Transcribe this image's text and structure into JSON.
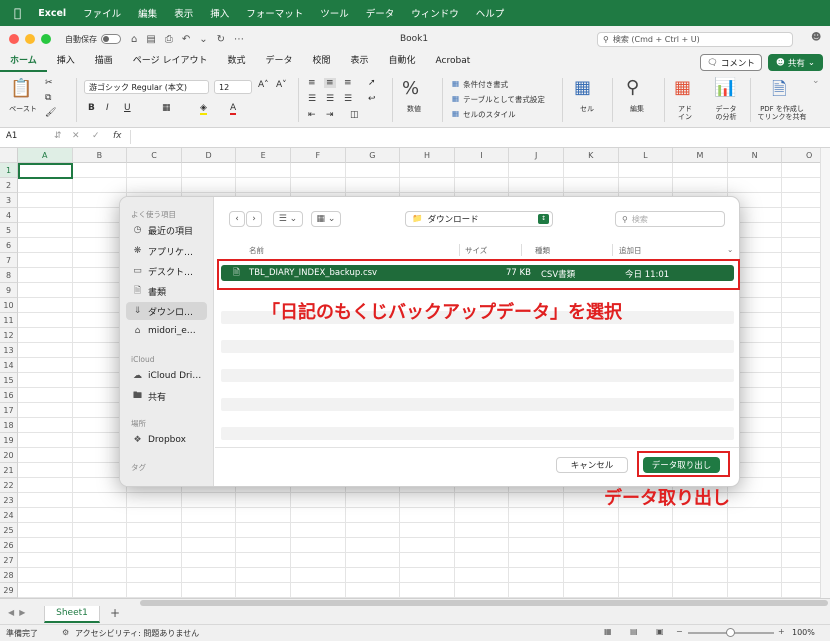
{
  "menubar": {
    "apple": "",
    "app": "Excel",
    "items": [
      "ファイル",
      "編集",
      "表示",
      "挿入",
      "フォーマット",
      "ツール",
      "データ",
      "ウィンドウ",
      "ヘルプ"
    ]
  },
  "titlebar": {
    "autosave": "自動保存",
    "doc_title": "Book1",
    "search_placeholder": "検索 (Cmd + Ctrl + U)"
  },
  "ribbon_tabs": [
    "ホーム",
    "挿入",
    "描画",
    "ページ レイアウト",
    "数式",
    "データ",
    "校閲",
    "表示",
    "自動化",
    "Acrobat"
  ],
  "ribbon_buttons": {
    "comment": "コメント",
    "share": "共有"
  },
  "ribbon": {
    "paste": "ペースト",
    "font_name": "游ゴシック Regular (本文)",
    "font_size": "12",
    "bold": "B",
    "italic": "I",
    "underline": "U",
    "number_label": "数値",
    "cond_format": "条件付き書式",
    "table_format": "テーブルとして書式設定",
    "cell_style": "セルのスタイル",
    "cells": "セル",
    "editing": "編集",
    "addin_1": "アド",
    "addin_2": "イン",
    "analysis_1": "データ",
    "analysis_2": "の分析",
    "pdf_1": "PDF を作成し",
    "pdf_2": "てリンクを共有"
  },
  "formula_bar": {
    "cell_ref": "A1",
    "fx": "fx"
  },
  "grid": {
    "columns": [
      "A",
      "B",
      "C",
      "D",
      "E",
      "F",
      "G",
      "H",
      "I",
      "J",
      "K",
      "L",
      "M",
      "N",
      "O"
    ],
    "rows": [
      "1",
      "2",
      "3",
      "4",
      "5",
      "6",
      "7",
      "8",
      "9",
      "10",
      "11",
      "12",
      "13",
      "14",
      "15",
      "16",
      "17",
      "18",
      "19",
      "20",
      "21",
      "22",
      "23",
      "24",
      "25",
      "26",
      "27",
      "28",
      "29"
    ]
  },
  "sheets": {
    "active": "Sheet1",
    "add": "+"
  },
  "status": {
    "ready": "準備完了",
    "accessibility": "アクセシビリティ: 問題ありません",
    "zoom": "100%"
  },
  "dialog": {
    "sidebar": {
      "favorites_header": "よく使う項目",
      "favorites": [
        "最近の項目",
        "アプリケ…",
        "デスクト…",
        "書類",
        "ダウンロ…",
        "midori_e…"
      ],
      "icloud_header": "iCloud",
      "icloud": [
        "iCloud Dri…",
        "共有"
      ],
      "places_header": "場所",
      "places": [
        "Dropbox"
      ],
      "tags_header": "タグ"
    },
    "location": "ダウンロード",
    "search_placeholder": "検索",
    "columns": {
      "name": "名前",
      "size": "サイズ",
      "kind": "種類",
      "date": "追加日"
    },
    "file": {
      "name": "TBL_DIARY_INDEX_backup.csv",
      "size": "77 KB",
      "kind": "CSV書類",
      "date": "今日 11:01"
    },
    "cancel": "キャンセル",
    "open": "データ取り出し"
  },
  "annotations": {
    "select_note": "「日記のもくじバックアップデータ」を選択",
    "open_note": "データ取り出し"
  },
  "colors": {
    "accent": "#1f7a43",
    "annotation": "#e02020",
    "selected_row": "#1f6b3a"
  }
}
